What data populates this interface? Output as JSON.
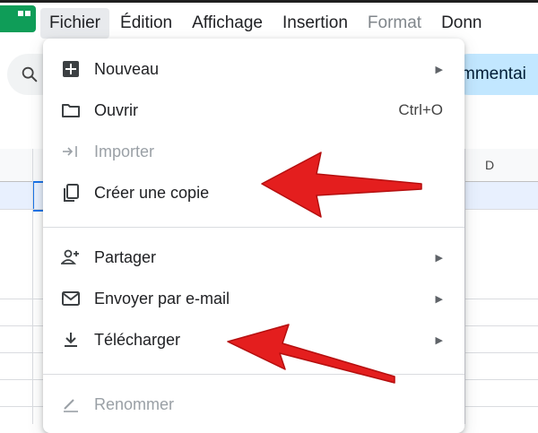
{
  "menubar": {
    "items": [
      {
        "label": "Fichier",
        "active": true,
        "disabled": false
      },
      {
        "label": "Édition",
        "active": false,
        "disabled": false
      },
      {
        "label": "Affichage",
        "active": false,
        "disabled": false
      },
      {
        "label": "Insertion",
        "active": false,
        "disabled": false
      },
      {
        "label": "Format",
        "active": false,
        "disabled": true
      },
      {
        "label": "Donn",
        "active": false,
        "disabled": false
      }
    ]
  },
  "toolbar": {
    "comment_label": "mmentai"
  },
  "sheet": {
    "column_d": "D"
  },
  "file_menu": {
    "items": [
      {
        "label": "Nouveau",
        "icon": "new-sheet-icon",
        "submenu": true,
        "disabled": false
      },
      {
        "label": "Ouvrir",
        "icon": "folder-icon",
        "shortcut": "Ctrl+O",
        "disabled": false
      },
      {
        "label": "Importer",
        "icon": "import-icon",
        "disabled": true
      },
      {
        "label": "Créer une copie",
        "icon": "copy-icon",
        "disabled": false
      },
      {
        "label": "Partager",
        "icon": "person-add-icon",
        "submenu": true,
        "disabled": false
      },
      {
        "label": "Envoyer par e-mail",
        "icon": "mail-icon",
        "submenu": true,
        "disabled": false
      },
      {
        "label": "Télécharger",
        "icon": "download-icon",
        "submenu": true,
        "disabled": false
      },
      {
        "label": "Renommer",
        "icon": "rename-icon",
        "disabled": true
      }
    ]
  },
  "colors": {
    "accent": "#1a73e8",
    "arrow_annotation": "#e41e1e",
    "sheets_green": "#0f9d58"
  }
}
